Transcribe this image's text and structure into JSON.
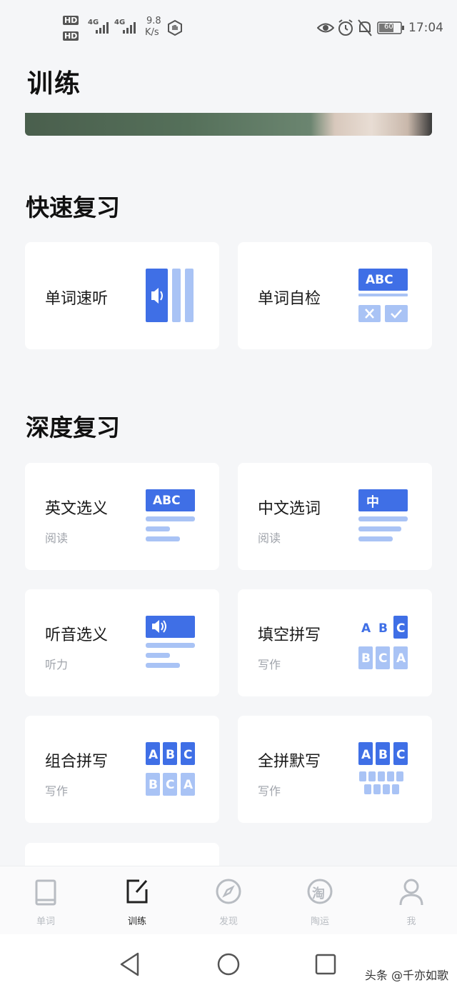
{
  "status_bar": {
    "hd1": "HD",
    "hd2": "HD",
    "net1": "4G",
    "net2": "4G",
    "speed_value": "9.8",
    "speed_unit": "K/s",
    "battery": "60",
    "time": "17:04"
  },
  "page": {
    "title": "训练"
  },
  "sections": {
    "quick": {
      "title": "快速复习"
    },
    "deep": {
      "title": "深度复习"
    }
  },
  "cards": {
    "word_listen": {
      "title": "单词速听"
    },
    "word_check": {
      "title": "单词自检",
      "badge": "ABC"
    },
    "en_choice": {
      "title": "英文选义",
      "subtitle": "阅读",
      "badge": "ABC"
    },
    "cn_choice": {
      "title": "中文选词",
      "subtitle": "阅读",
      "badge": "中"
    },
    "listen_choice": {
      "title": "听音选义",
      "subtitle": "听力"
    },
    "fill_spell": {
      "title": "填空拼写",
      "subtitle": "写作",
      "letters_top": [
        "A",
        "B",
        "C"
      ],
      "letters_bottom": [
        "B",
        "C",
        "A"
      ]
    },
    "combo_spell": {
      "title": "组合拼写",
      "subtitle": "写作",
      "letters_top": [
        "A",
        "B",
        "C"
      ],
      "letters_bottom": [
        "B",
        "C",
        "A"
      ]
    },
    "full_spell": {
      "title": "全拼默写",
      "subtitle": "写作",
      "letters_top": [
        "A",
        "B",
        "C"
      ]
    }
  },
  "tabs": [
    {
      "label": "单词",
      "icon": "book-icon"
    },
    {
      "label": "训练",
      "icon": "edit-icon",
      "active": true
    },
    {
      "label": "发现",
      "icon": "compass-icon"
    },
    {
      "label": "陶运",
      "icon": "tao-icon",
      "glyph": "淘"
    },
    {
      "label": "我",
      "icon": "person-icon"
    }
  ],
  "watermark": "头条 @千亦如歌",
  "colors": {
    "accent": "#3f6fe6",
    "accent_light": "#a9c3f5",
    "background": "#f5f6f8"
  }
}
